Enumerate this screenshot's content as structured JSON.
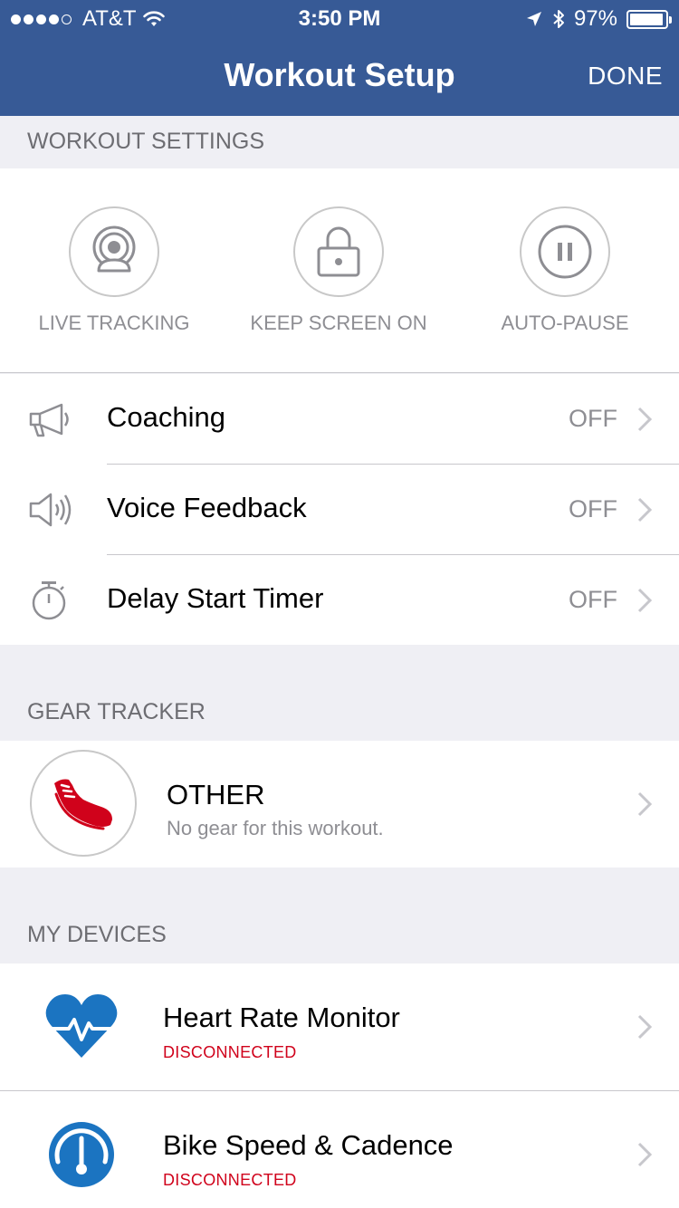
{
  "status_bar": {
    "carrier": "AT&T",
    "time": "3:50 PM",
    "battery": "97%"
  },
  "nav": {
    "title": "Workout Setup",
    "done_label": "DONE"
  },
  "workout_settings": {
    "header": "WORKOUT SETTINGS",
    "quick_toggles": [
      {
        "label": "LIVE TRACKING",
        "icon": "live-tracking-icon"
      },
      {
        "label": "KEEP SCREEN ON",
        "icon": "lock-icon"
      },
      {
        "label": "AUTO-PAUSE",
        "icon": "pause-icon"
      }
    ],
    "rows": [
      {
        "label": "Coaching",
        "value": "OFF",
        "icon": "megaphone-icon"
      },
      {
        "label": "Voice Feedback",
        "value": "OFF",
        "icon": "speaker-icon"
      },
      {
        "label": "Delay Start Timer",
        "value": "OFF",
        "icon": "stopwatch-icon"
      }
    ]
  },
  "gear_tracker": {
    "header": "GEAR TRACKER",
    "name": "OTHER",
    "subtitle": "No gear for this workout.",
    "icon": "shoe-icon",
    "icon_color": "#d0021b"
  },
  "my_devices": {
    "header": "MY DEVICES",
    "devices": [
      {
        "name": "Heart Rate Monitor",
        "status": "DISCONNECTED",
        "icon": "heart-rate-icon"
      },
      {
        "name": "Bike Speed & Cadence",
        "status": "DISCONNECTED",
        "icon": "speedometer-icon"
      }
    ]
  },
  "colors": {
    "header_bg": "#375a96",
    "device_blue": "#1b74c1",
    "status_red": "#d0021b"
  }
}
